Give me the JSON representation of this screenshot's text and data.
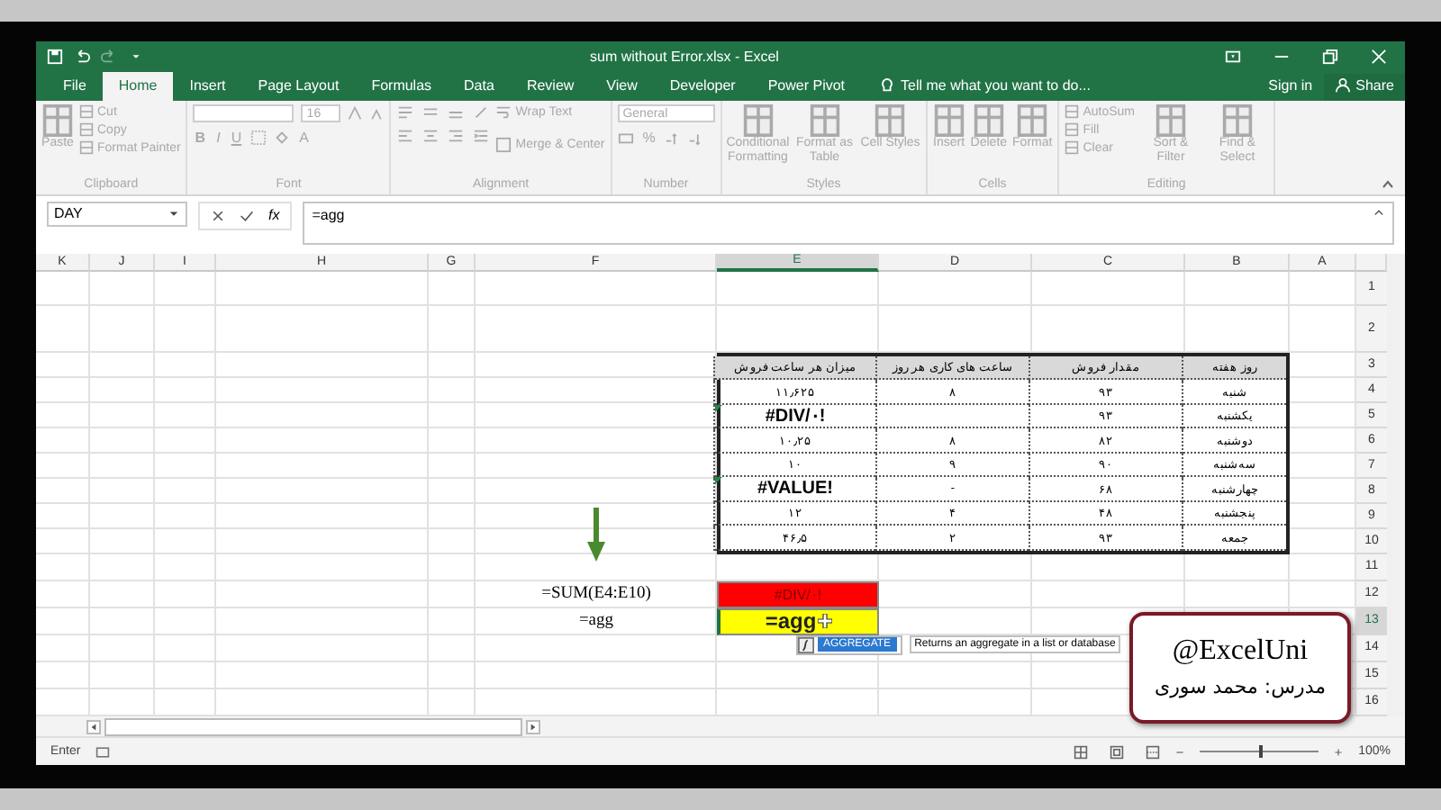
{
  "window": {
    "title": "sum without Error.xlsx - Excel"
  },
  "tabs": [
    {
      "label": "File",
      "selected": false
    },
    {
      "label": "Home",
      "selected": true
    },
    {
      "label": "Insert",
      "selected": false
    },
    {
      "label": "Page Layout",
      "selected": false
    },
    {
      "label": "Formulas",
      "selected": false
    },
    {
      "label": "Data",
      "selected": false
    },
    {
      "label": "Review",
      "selected": false
    },
    {
      "label": "View",
      "selected": false
    },
    {
      "label": "Developer",
      "selected": false
    },
    {
      "label": "Power Pivot",
      "selected": false
    }
  ],
  "tell_me": "Tell me what you want to do...",
  "sign_in": "Sign in",
  "share": "Share",
  "ribbon": {
    "disabled": true,
    "groups": [
      {
        "kind": "buttons",
        "label": "Clipboard",
        "items": [
          {
            "kind": "large",
            "label": "Paste"
          },
          {
            "kind": "small",
            "label": "Cut"
          },
          {
            "kind": "small",
            "label": "Copy"
          },
          {
            "kind": "small",
            "label": "Format Painter"
          }
        ]
      },
      {
        "kind": "font",
        "label": "Font",
        "size": "16",
        "buttons": [
          "B",
          "I",
          "U"
        ],
        "color_button": "A"
      },
      {
        "kind": "alignment",
        "label": "Alignment",
        "wrap": "Wrap Text",
        "merge": "Merge & Center"
      },
      {
        "kind": "number",
        "label": "Number",
        "format": "General",
        "buttons": [
          "%"
        ]
      },
      {
        "kind": "buttons",
        "label": "Styles",
        "items": [
          {
            "kind": "large",
            "label": "Conditional Formatting"
          },
          {
            "kind": "large",
            "label": "Format as Table"
          },
          {
            "kind": "large",
            "label": "Cell Styles"
          }
        ]
      },
      {
        "kind": "buttons",
        "label": "Cells",
        "items": [
          {
            "kind": "large",
            "label": "Insert"
          },
          {
            "kind": "large",
            "label": "Delete"
          },
          {
            "kind": "large",
            "label": "Format"
          }
        ]
      },
      {
        "kind": "buttons",
        "label": "Editing",
        "items": [
          {
            "kind": "small",
            "label": "AutoSum"
          },
          {
            "kind": "small",
            "label": "Fill"
          },
          {
            "kind": "small",
            "label": "Clear"
          },
          {
            "kind": "large",
            "label": "Sort & Filter"
          },
          {
            "kind": "large",
            "label": "Find & Select"
          }
        ]
      }
    ]
  },
  "formula_bar": {
    "name_box": "DAY",
    "function_label": "fx",
    "formula": "=agg"
  },
  "sheet": {
    "columns": [
      {
        "label": "K",
        "selected": false
      },
      {
        "label": "J",
        "selected": false
      },
      {
        "label": "I",
        "selected": false
      },
      {
        "label": "H",
        "selected": false
      },
      {
        "label": "G",
        "selected": false
      },
      {
        "label": "F",
        "selected": false
      },
      {
        "label": "E",
        "selected": true
      },
      {
        "label": "D",
        "selected": false
      },
      {
        "label": "C",
        "selected": false
      },
      {
        "label": "B",
        "selected": false
      },
      {
        "label": "A",
        "selected": false
      }
    ],
    "rows": [
      {
        "label": "1",
        "selected": false
      },
      {
        "label": "2",
        "selected": false
      },
      {
        "label": "3",
        "selected": false
      },
      {
        "label": "4",
        "selected": false
      },
      {
        "label": "5",
        "selected": false
      },
      {
        "label": "6",
        "selected": false
      },
      {
        "label": "7",
        "selected": false
      },
      {
        "label": "8",
        "selected": false
      },
      {
        "label": "9",
        "selected": false
      },
      {
        "label": "10",
        "selected": false
      },
      {
        "label": "11",
        "selected": false
      },
      {
        "label": "12",
        "selected": false
      },
      {
        "label": "13",
        "selected": true
      },
      {
        "label": "14",
        "selected": false
      },
      {
        "label": "15",
        "selected": false
      },
      {
        "label": "16",
        "selected": false
      }
    ]
  },
  "table": {
    "header": {
      "day": "روز هفته",
      "sales": "مقدار فروش",
      "hours": "ساعت های کاری هر روز",
      "rate": "میزان هر ساعت فروش"
    },
    "rows": [
      {
        "day": "شنبه",
        "sales": "۹۳",
        "hours": "۸",
        "rate": "۱۱٫۶۲۵",
        "error": false
      },
      {
        "day": "یکشنبه",
        "sales": "۹۳",
        "rate": "#DIV/۰!",
        "error": true
      },
      {
        "day": "دوشنبه",
        "sales": "۸۲",
        "hours": "۸",
        "rate": "۱۰٫۲۵",
        "error": false
      },
      {
        "day": "سه‌شنبه",
        "sales": "۹۰",
        "hours": "۹",
        "rate": "۱۰",
        "error": false
      },
      {
        "day": "چهارشنبه",
        "sales": "۶۸",
        "hours": "-",
        "rate": "#VALUE!",
        "error": true
      },
      {
        "day": "پنجشنبه",
        "sales": "۴۸",
        "hours": "۴",
        "rate": "۱۲",
        "error": false
      },
      {
        "day": "جمعه",
        "sales": "۹۳",
        "hours": "۲",
        "rate": "۴۶٫۵",
        "error": false
      }
    ]
  },
  "formulas": [
    {
      "formula": "=SUM(E4:E10)",
      "result": "#DIV/۰!",
      "color": "#ff0000",
      "editing": false
    },
    {
      "formula": "=agg",
      "result": "=agg",
      "color": "#ffff00",
      "editing": true
    }
  ],
  "autocomplete": {
    "items": [
      {
        "label": "AGGREGATE",
        "selected": true
      }
    ],
    "tooltip": "Returns an aggregate in a list or database"
  },
  "callout": {
    "handle": "@ExcelUni",
    "text": "مدرس: محمد سوری"
  },
  "status_bar": {
    "mode": "Enter",
    "zoom": {
      "reading": "100%",
      "level": 0.5
    }
  }
}
